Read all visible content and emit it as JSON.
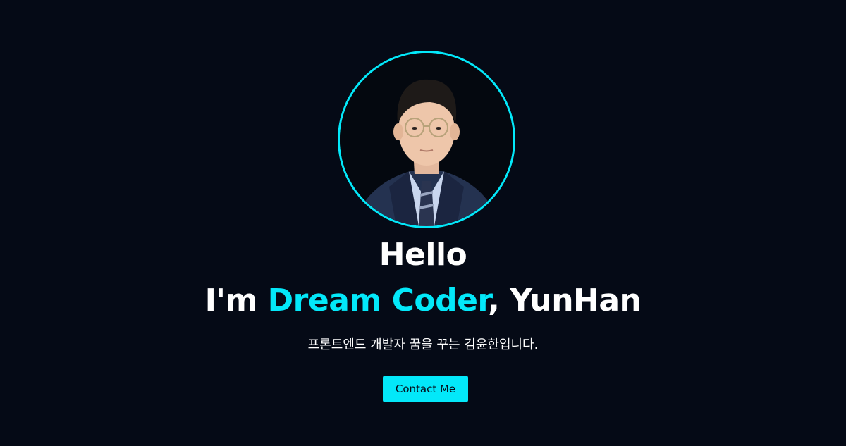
{
  "hero": {
    "avatar_alt": "profile photo",
    "greeting": "Hello",
    "intro_prefix": "I'm ",
    "intro_highlight": "Dream Coder",
    "intro_suffix": ", YunHan",
    "description": "프론트엔드 개발자 꿈을 꾸는 김윤한입니다.",
    "contact_label": "Contact Me"
  },
  "colors": {
    "background": "#050a16",
    "accent": "#03e8f9",
    "text": "#ffffff"
  }
}
